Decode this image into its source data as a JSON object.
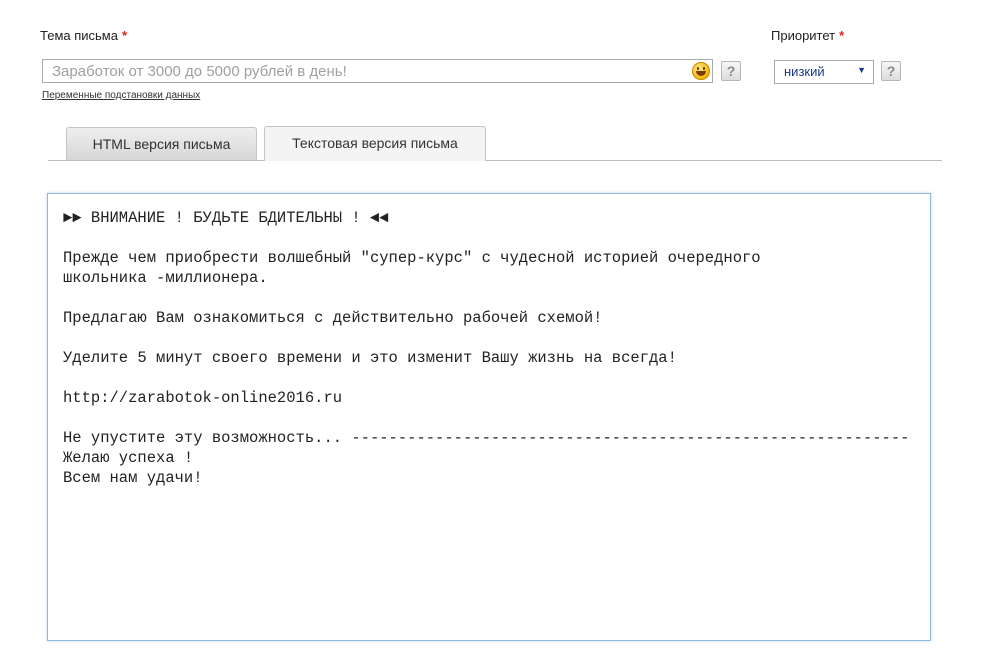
{
  "subject": {
    "label": "Тема письма",
    "required_mark": "*",
    "placeholder": "Заработок от 3000 до 5000 рублей в день!",
    "help": "?",
    "vars_link": "Переменные подстановки данных"
  },
  "priority": {
    "label": "Приоритет",
    "required_mark": "*",
    "value": "низкий",
    "help": "?"
  },
  "tabs": [
    {
      "label": "HTML версия письма",
      "active": false
    },
    {
      "label": "Текстовая версия письма",
      "active": true
    }
  ],
  "body_text": "►► ВНИМАНИЕ ! БУДЬТЕ БДИТЕЛЬНЫ ! ◄◄\n\nПрежде чем приобрести волшебный \"супер-курс\" с чудесной историей очередного\nшкольника -миллионера.\n\nПредлагаю Вам ознакомиться с действительно рабочей схемой!\n\nУделите 5 минут своего времени и это изменит Вашу жизнь на всегда!\n\nhttp://zarabotok-online2016.ru\n\nНе упустите эту возможность... ------------------------------------------------------------\nЖелаю успеха !\nВсем нам удачи!",
  "colors": {
    "required": "#e02020",
    "focus_border": "#8fb9e0",
    "select_text": "#1a3a8a"
  }
}
